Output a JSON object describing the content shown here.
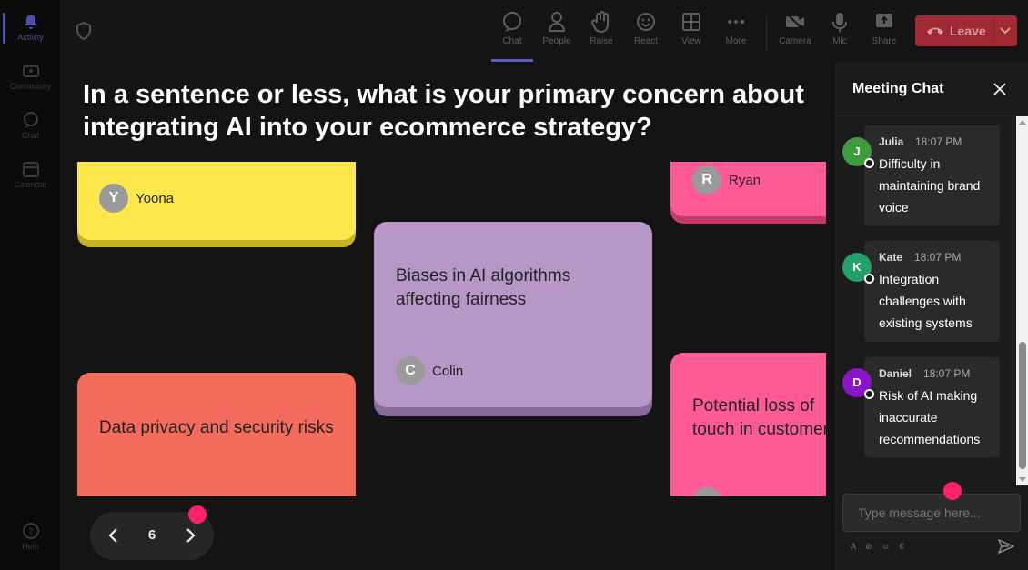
{
  "rail": {
    "items": [
      {
        "label": "Activity",
        "icon": "bell-icon",
        "active": true
      },
      {
        "label": "Community",
        "icon": "community-icon"
      },
      {
        "label": "Chat",
        "icon": "chat-icon"
      },
      {
        "label": "Calendar",
        "icon": "calendar-icon"
      }
    ],
    "help": "Help"
  },
  "toolbar": {
    "chat": "Chat",
    "people": "People",
    "raise": "Raise",
    "react": "React",
    "view": "View",
    "more": "More",
    "camera": "Camera",
    "mic": "Mic",
    "share": "Share",
    "leave": "Leave"
  },
  "board": {
    "question": "In a sentence or less, what is your primary concern about integrating AI into your ecommerce strategy?",
    "cards": [
      {
        "text": "",
        "author": "Yoona",
        "initial": "Y",
        "color": "#fde74c"
      },
      {
        "text": "Biases in AI algorithms affecting fairness",
        "author": "Colin",
        "initial": "C",
        "color": "#b797c6"
      },
      {
        "text": "",
        "author": "Ryan",
        "initial": "R",
        "color": "#fe5a97"
      },
      {
        "text": "Data privacy and security risks",
        "author": "",
        "initial": "",
        "color": "#f26b5d"
      },
      {
        "text": "Potential loss of touch in customer",
        "author": "",
        "initial": "",
        "color": "#fe5a97"
      }
    ],
    "page": "6"
  },
  "chat": {
    "title": "Meeting Chat",
    "messages": [
      {
        "name": "Julia",
        "initial": "J",
        "time": "18:07 PM",
        "text": "Difficulty in maintaining brand voice",
        "color": "#3f9b3f"
      },
      {
        "name": "Kate",
        "initial": "K",
        "time": "18:07 PM",
        "text": "Integration challenges with existing systems",
        "color": "#23a06c"
      },
      {
        "name": "Daniel",
        "initial": "D",
        "time": "18:07 PM",
        "text": "Risk of AI making inaccurate recommendations",
        "color": "#8a15c6"
      }
    ],
    "compose_placeholder": "Type message here...",
    "tools": "A ⊘ ☺ €"
  }
}
